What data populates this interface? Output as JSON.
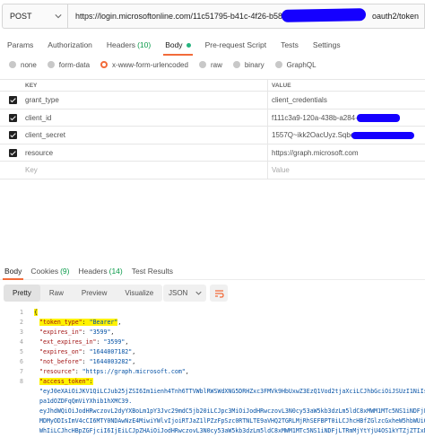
{
  "request": {
    "method": "POST",
    "url_prefix": "https://login.microsoftonline.com/11c51795-b41c-4f26-b58",
    "url_suffix": "oauth2/token"
  },
  "request_tabs": [
    {
      "label": "Params"
    },
    {
      "label": "Authorization"
    },
    {
      "label": "Headers",
      "count": "(10)"
    },
    {
      "label": "Body"
    },
    {
      "label": "Pre-request Script"
    },
    {
      "label": "Tests"
    },
    {
      "label": "Settings"
    }
  ],
  "body_types": [
    "none",
    "form-data",
    "x-www-form-urlencoded",
    "raw",
    "binary",
    "GraphQL"
  ],
  "selected_body_type": "x-www-form-urlencoded",
  "kv_table": {
    "key_header": "KEY",
    "value_header": "VALUE",
    "rows": [
      {
        "key": "grant_type",
        "value": "client_credentials"
      },
      {
        "key": "client_id",
        "value": "f111c3a9-120a-438b-a284-a"
      },
      {
        "key": "client_secret",
        "value": "1557Q~ikk2OacUyz.Sqbc~"
      },
      {
        "key": "resource",
        "value": "https://graph.microsoft.com"
      }
    ],
    "placeholder_key": "Key",
    "placeholder_value": "Value"
  },
  "response_tabs": [
    {
      "label": "Body"
    },
    {
      "label": "Cookies",
      "count": "(9)"
    },
    {
      "label": "Headers",
      "count": "(14)"
    },
    {
      "label": "Test Results"
    }
  ],
  "view_modes": [
    "Pretty",
    "Raw",
    "Preview",
    "Visualize"
  ],
  "format": "JSON",
  "code_lines": {
    "l1": "{",
    "l2_key": "\"token_type\"",
    "l2_val": "\"Bearer\"",
    "l3_key": "\"expires_in\"",
    "l3_val": "\"3599\"",
    "l4_key": "\"ext_expires_in\"",
    "l4_val": "\"3599\"",
    "l5_key": "\"expires_on\"",
    "l5_val": "\"1644007182\"",
    "l6_key": "\"not_before\"",
    "l6_val": "\"1644003282\"",
    "l7_key": "\"resource\"",
    "l7_val": "\"https://graph.microsoft.com\"",
    "l8_key": "\"access_token\"",
    "token_1": "\"eyJ0eXAiOiJKV1QiLCJub25jZSI6Im1ienh4Tnh6TTVWblRWSWdXNG5DRHZxc3FMVk9HbUxwZ3EzQ1Vod2tjaXciLCJhbGciOiJSUzI1NiIsIng1dCI6Ik1yNS1BVWliZkJpaTdOZDFqQmViYXhib1hXQSIsImtpZCI6Ik1yNS1BVWliZkJpaTdOZDFqQmViYXhib1hXQSJ9.",
    "token_2": "pa1dOZDFqQmViYXhib1hXMC39.",
    "token_3": "eyJhdWQiOiJodHRwczovL2dyYXBoLm1pY3Jvc29mdC5jb20iLCJpc3MiOiJodHRwczovL3N0cy53aW5kb3dzLm5ldC8xMWM1MTc5NS1iNDFjLTRmMjYtYjU4",
    "token_4": "MDMyODIsImV4cCI6MTY0NDAwNzE4MiwiYWlvIjoiRTJaZ1lPZzFpSzc0RTNLTE9aVHQ2TGRLMjRhSEFBPT0iLCJhcHBfZGlzcGxheW5hbWUiOiJHcmFwaA",
    "token_5": "WhIiLCJhcHBpZGFjciI6IjEiLCJpZHAiOiJodHRwczovL3N0cy53aW5kb3dzLm5ldC8xMWM1MTc5NS1iNDFjLTRmMjYtYjU4OS1kYTZjZTIxNmVjMWUvIiwiaWR0eXAiOiJhcHAiLCJvaWQiOiI"
  }
}
